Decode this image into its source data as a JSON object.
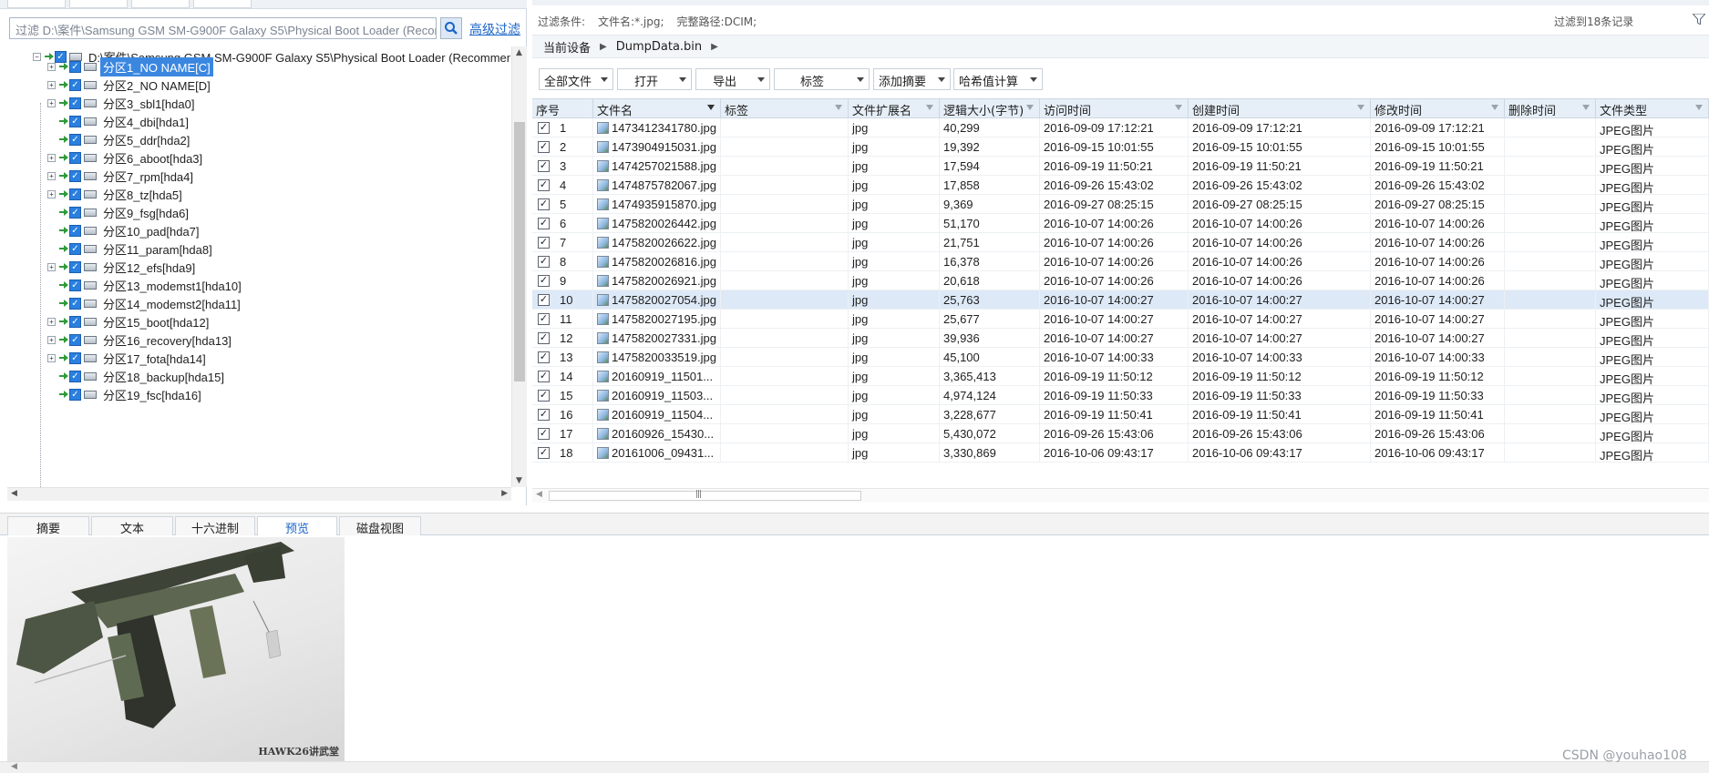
{
  "left": {
    "filter_placeholder": "过滤 D:\\案件\\Samsung GSM SM-G900F Galaxy S5\\Physical Boot Loader (Recom",
    "advanced_filter": "高级过滤",
    "tree_root": "D:\\案件\\Samsung GSM SM-G900F Galaxy S5\\Physical Boot Loader (Recommende",
    "tree_items": [
      {
        "label": "分区1_NO NAME[C]",
        "expandable": true,
        "selected": true
      },
      {
        "label": "分区2_NO NAME[D]",
        "expandable": true,
        "selected": false
      },
      {
        "label": "分区3_sbl1[hda0]",
        "expandable": true,
        "selected": false
      },
      {
        "label": "分区4_dbi[hda1]",
        "expandable": false,
        "selected": false
      },
      {
        "label": "分区5_ddr[hda2]",
        "expandable": false,
        "selected": false
      },
      {
        "label": "分区6_aboot[hda3]",
        "expandable": true,
        "selected": false
      },
      {
        "label": "分区7_rpm[hda4]",
        "expandable": true,
        "selected": false
      },
      {
        "label": "分区8_tz[hda5]",
        "expandable": true,
        "selected": false
      },
      {
        "label": "分区9_fsg[hda6]",
        "expandable": false,
        "selected": false
      },
      {
        "label": "分区10_pad[hda7]",
        "expandable": false,
        "selected": false
      },
      {
        "label": "分区11_param[hda8]",
        "expandable": false,
        "selected": false
      },
      {
        "label": "分区12_efs[hda9]",
        "expandable": true,
        "selected": false
      },
      {
        "label": "分区13_modemst1[hda10]",
        "expandable": false,
        "selected": false
      },
      {
        "label": "分区14_modemst2[hda11]",
        "expandable": false,
        "selected": false
      },
      {
        "label": "分区15_boot[hda12]",
        "expandable": true,
        "selected": false
      },
      {
        "label": "分区16_recovery[hda13]",
        "expandable": true,
        "selected": false
      },
      {
        "label": "分区17_fota[hda14]",
        "expandable": true,
        "selected": false
      },
      {
        "label": "分区18_backup[hda15]",
        "expandable": false,
        "selected": false
      },
      {
        "label": "分区19_fsc[hda16]",
        "expandable": false,
        "selected": false
      }
    ]
  },
  "right": {
    "filter_label": "过滤条件:",
    "filter_name": "文件名:*.jpg;",
    "filter_path": "完整路径:DCIM;",
    "filter_count": "过滤到18条记录",
    "breadcrumb": [
      "当前设备",
      "DumpData.bin"
    ],
    "toolbar": [
      "全部文件",
      "打开",
      "导出",
      "标签",
      "添加摘要",
      "哈希值计算"
    ],
    "columns": [
      "序号",
      "文件名",
      "标签",
      "文件扩展名",
      "逻辑大小(字节)",
      "访问时间",
      "创建时间",
      "修改时间",
      "删除时间",
      "文件类型"
    ],
    "rows": [
      {
        "no": "1",
        "name": "1473412341780.jpg",
        "tag": "",
        "ext": "jpg",
        "size": "40,299",
        "access": "2016-09-09 17:12:21",
        "created": "2016-09-09 17:12:21",
        "modified": "2016-09-09 17:12:21",
        "deleted": "",
        "type": "JPEG图片",
        "selected": false
      },
      {
        "no": "2",
        "name": "1473904915031.jpg",
        "tag": "",
        "ext": "jpg",
        "size": "19,392",
        "access": "2016-09-15 10:01:55",
        "created": "2016-09-15 10:01:55",
        "modified": "2016-09-15 10:01:55",
        "deleted": "",
        "type": "JPEG图片",
        "selected": false
      },
      {
        "no": "3",
        "name": "1474257021588.jpg",
        "tag": "",
        "ext": "jpg",
        "size": "17,594",
        "access": "2016-09-19 11:50:21",
        "created": "2016-09-19 11:50:21",
        "modified": "2016-09-19 11:50:21",
        "deleted": "",
        "type": "JPEG图片",
        "selected": false
      },
      {
        "no": "4",
        "name": "1474875782067.jpg",
        "tag": "",
        "ext": "jpg",
        "size": "17,858",
        "access": "2016-09-26 15:43:02",
        "created": "2016-09-26 15:43:02",
        "modified": "2016-09-26 15:43:02",
        "deleted": "",
        "type": "JPEG图片",
        "selected": false
      },
      {
        "no": "5",
        "name": "1474935915870.jpg",
        "tag": "",
        "ext": "jpg",
        "size": "9,369",
        "access": "2016-09-27 08:25:15",
        "created": "2016-09-27 08:25:15",
        "modified": "2016-09-27 08:25:15",
        "deleted": "",
        "type": "JPEG图片",
        "selected": false
      },
      {
        "no": "6",
        "name": "1475820026442.jpg",
        "tag": "",
        "ext": "jpg",
        "size": "51,170",
        "access": "2016-10-07 14:00:26",
        "created": "2016-10-07 14:00:26",
        "modified": "2016-10-07 14:00:26",
        "deleted": "",
        "type": "JPEG图片",
        "selected": false
      },
      {
        "no": "7",
        "name": "1475820026622.jpg",
        "tag": "",
        "ext": "jpg",
        "size": "21,751",
        "access": "2016-10-07 14:00:26",
        "created": "2016-10-07 14:00:26",
        "modified": "2016-10-07 14:00:26",
        "deleted": "",
        "type": "JPEG图片",
        "selected": false
      },
      {
        "no": "8",
        "name": "1475820026816.jpg",
        "tag": "",
        "ext": "jpg",
        "size": "16,378",
        "access": "2016-10-07 14:00:26",
        "created": "2016-10-07 14:00:26",
        "modified": "2016-10-07 14:00:26",
        "deleted": "",
        "type": "JPEG图片",
        "selected": false
      },
      {
        "no": "9",
        "name": "1475820026921.jpg",
        "tag": "",
        "ext": "jpg",
        "size": "20,618",
        "access": "2016-10-07 14:00:26",
        "created": "2016-10-07 14:00:26",
        "modified": "2016-10-07 14:00:26",
        "deleted": "",
        "type": "JPEG图片",
        "selected": false
      },
      {
        "no": "10",
        "name": "1475820027054.jpg",
        "tag": "",
        "ext": "jpg",
        "size": "25,763",
        "access": "2016-10-07 14:00:27",
        "created": "2016-10-07 14:00:27",
        "modified": "2016-10-07 14:00:27",
        "deleted": "",
        "type": "JPEG图片",
        "selected": true
      },
      {
        "no": "11",
        "name": "1475820027195.jpg",
        "tag": "",
        "ext": "jpg",
        "size": "25,677",
        "access": "2016-10-07 14:00:27",
        "created": "2016-10-07 14:00:27",
        "modified": "2016-10-07 14:00:27",
        "deleted": "",
        "type": "JPEG图片",
        "selected": false
      },
      {
        "no": "12",
        "name": "1475820027331.jpg",
        "tag": "",
        "ext": "jpg",
        "size": "39,936",
        "access": "2016-10-07 14:00:27",
        "created": "2016-10-07 14:00:27",
        "modified": "2016-10-07 14:00:27",
        "deleted": "",
        "type": "JPEG图片",
        "selected": false
      },
      {
        "no": "13",
        "name": "1475820033519.jpg",
        "tag": "",
        "ext": "jpg",
        "size": "45,100",
        "access": "2016-10-07 14:00:33",
        "created": "2016-10-07 14:00:33",
        "modified": "2016-10-07 14:00:33",
        "deleted": "",
        "type": "JPEG图片",
        "selected": false
      },
      {
        "no": "14",
        "name": "20160919_11501...",
        "tag": "",
        "ext": "jpg",
        "size": "3,365,413",
        "access": "2016-09-19 11:50:12",
        "created": "2016-09-19 11:50:12",
        "modified": "2016-09-19 11:50:12",
        "deleted": "",
        "type": "JPEG图片",
        "selected": false
      },
      {
        "no": "15",
        "name": "20160919_11503...",
        "tag": "",
        "ext": "jpg",
        "size": "4,974,124",
        "access": "2016-09-19 11:50:33",
        "created": "2016-09-19 11:50:33",
        "modified": "2016-09-19 11:50:33",
        "deleted": "",
        "type": "JPEG图片",
        "selected": false
      },
      {
        "no": "16",
        "name": "20160919_11504...",
        "tag": "",
        "ext": "jpg",
        "size": "3,228,677",
        "access": "2016-09-19 11:50:41",
        "created": "2016-09-19 11:50:41",
        "modified": "2016-09-19 11:50:41",
        "deleted": "",
        "type": "JPEG图片",
        "selected": false
      },
      {
        "no": "17",
        "name": "20160926_15430...",
        "tag": "",
        "ext": "jpg",
        "size": "5,430,072",
        "access": "2016-09-26 15:43:06",
        "created": "2016-09-26 15:43:06",
        "modified": "2016-09-26 15:43:06",
        "deleted": "",
        "type": "JPEG图片",
        "selected": false
      },
      {
        "no": "18",
        "name": "20161006_09431...",
        "tag": "",
        "ext": "jpg",
        "size": "3,330,869",
        "access": "2016-10-06 09:43:17",
        "created": "2016-10-06 09:43:17",
        "modified": "2016-10-06 09:43:17",
        "deleted": "",
        "type": "JPEG图片",
        "selected": false
      }
    ]
  },
  "bottom": {
    "tabs": [
      "摘要",
      "文本",
      "十六进制",
      "预览",
      "磁盘视图"
    ],
    "active_tab": 3,
    "preview_watermark": "HAWK26讲武堂",
    "csdn": "CSDN @youhao108"
  },
  "colors": {
    "accent": "#1a64c8",
    "selection": "#3b87e0",
    "row_highlight": "#dde9f7",
    "header": "#e6eef7"
  }
}
